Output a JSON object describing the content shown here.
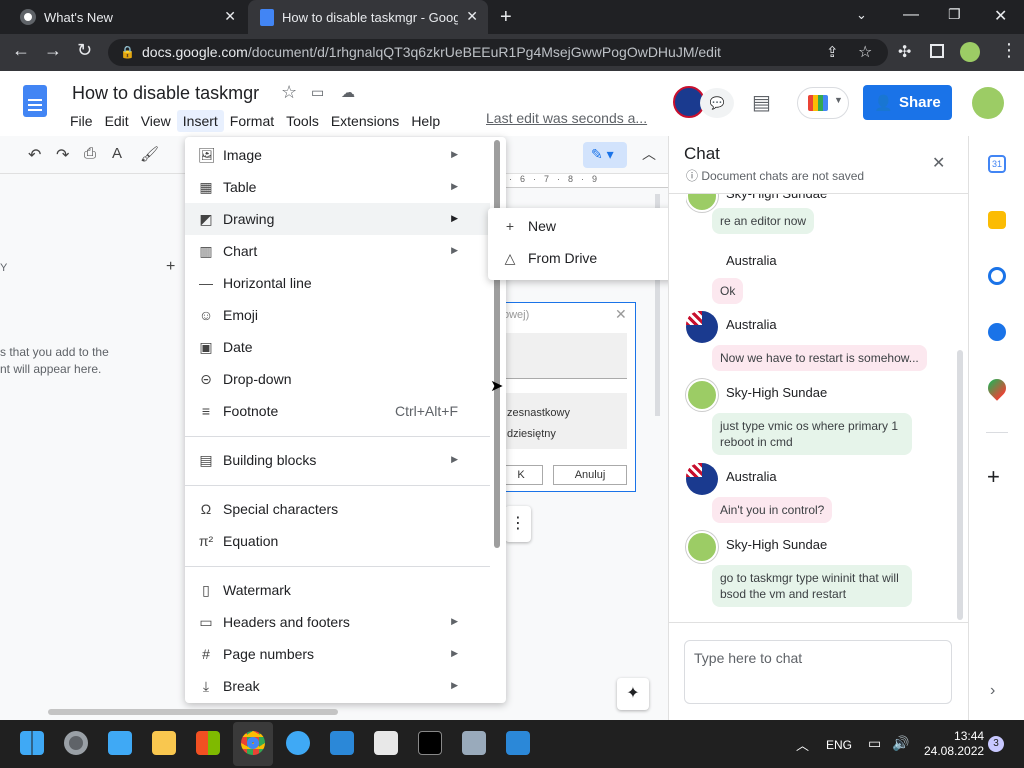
{
  "browser": {
    "tabs": [
      {
        "title": "What's New"
      },
      {
        "title": "How to disable taskmgr - Google"
      }
    ],
    "url_domain": "docs.google.com",
    "url_path": "/document/d/1rhgnalqQT3q6zkrUeBEEuR1Pg4MsejGwwPogOwDHuJM/edit"
  },
  "doc": {
    "title": "How to disable taskmgr",
    "menus": [
      "File",
      "Edit",
      "View",
      "Insert",
      "Format",
      "Tools",
      "Extensions",
      "Help"
    ],
    "last_edit": "Last edit was seconds a...",
    "share_label": "Share"
  },
  "left_panel": {
    "heading_fragment": "Y",
    "hint_line1": "s that you add to the",
    "hint_line2": "nt will appear here."
  },
  "insert_menu": {
    "items": [
      {
        "label": "Image",
        "icon": "image-icon",
        "submenu": true
      },
      {
        "label": "Table",
        "icon": "table-icon",
        "submenu": true
      },
      {
        "label": "Drawing",
        "icon": "drawing-icon",
        "submenu": true
      },
      {
        "label": "Chart",
        "icon": "chart-icon",
        "submenu": true
      },
      {
        "label": "Horizontal line",
        "icon": "horizontal-line-icon",
        "submenu": false
      },
      {
        "label": "Emoji",
        "icon": "emoji-icon",
        "submenu": false
      },
      {
        "label": "Date",
        "icon": "calendar-icon",
        "submenu": false
      },
      {
        "label": "Drop-down",
        "icon": "dropdown-icon",
        "submenu": false
      },
      {
        "label": "Footnote",
        "icon": "footnote-icon",
        "submenu": false,
        "shortcut": "Ctrl+Alt+F"
      },
      {
        "label": "Building blocks",
        "icon": "building-blocks-icon",
        "submenu": true
      },
      {
        "label": "Special characters",
        "icon": "omega-icon",
        "submenu": false
      },
      {
        "label": "Equation",
        "icon": "pi-icon",
        "submenu": false
      },
      {
        "label": "Watermark",
        "icon": "watermark-icon",
        "submenu": false
      },
      {
        "label": "Headers and footers",
        "icon": "headers-footers-icon",
        "submenu": true
      },
      {
        "label": "Page numbers",
        "icon": "hash-icon",
        "submenu": true
      },
      {
        "label": "Break",
        "icon": "break-icon",
        "submenu": true
      }
    ]
  },
  "drawing_submenu": {
    "items": [
      {
        "label": "New",
        "icon": "plus-icon"
      },
      {
        "label": "From Drive",
        "icon": "drive-icon"
      }
    ]
  },
  "embedded_dialog": {
    "title_fragment": "owej)",
    "option1": "zesnastkowy",
    "option2": "dziesiętny",
    "ok": "K",
    "cancel": "Anuluj"
  },
  "chat": {
    "title": "Chat",
    "subtitle": "Document chats are not saved",
    "messages": [
      {
        "author": "",
        "text": "re an editor now"
      },
      {
        "author": "Australia",
        "text": "Ok"
      },
      {
        "author": "Australia",
        "text": "Now we have to restart is somehow..."
      },
      {
        "author": "Sky-High Sundae",
        "text": "just type vmic os where primary 1 reboot in cmd"
      },
      {
        "author": "Australia",
        "text": "Ain't you in control?"
      },
      {
        "author": "Sky-High Sundae",
        "text": "go to taskmgr type wininit that will bsod the vm and restart"
      }
    ],
    "top_author_fragment": "Sky-High Sundae",
    "input_placeholder": "Type here to chat"
  },
  "taskbar": {
    "lang": "ENG",
    "time": "13:44",
    "date": "24.08.2022",
    "notifications": "3"
  },
  "colors": {
    "accent": "#1a73e8",
    "bubble_pink": "#fce8ef",
    "bubble_green": "#e6f4ea"
  }
}
